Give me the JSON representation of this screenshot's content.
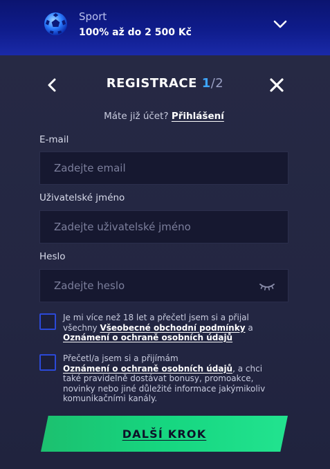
{
  "banner": {
    "title": "Sport",
    "offer": "100% až do 2 500 Kč",
    "icon": "football-icon",
    "accent": "#0f1c8c"
  },
  "header": {
    "title": "REGISTRACE",
    "step_current": "1",
    "step_total": "/2"
  },
  "login": {
    "prompt": "Máte již účet?",
    "link": "Přihlášení"
  },
  "form": {
    "email": {
      "label": "E-mail",
      "value": "",
      "placeholder": "Zadejte email"
    },
    "username": {
      "label": "Uživatelské jméno",
      "value": "",
      "placeholder": "Zadejte uživatelské jméno"
    },
    "password": {
      "label": "Heslo",
      "value": "",
      "placeholder": "Zadejte heslo"
    }
  },
  "consents": [
    {
      "checked": false,
      "text_before": "Je mi více než 18 let a přečetl jsem si a přijal všechny ",
      "link1": "Všeobecné obchodní podmínky",
      "text_mid": " a ",
      "link2": "Oznámení o ochraně osobních údajů"
    },
    {
      "checked": false,
      "text_before": "Přečetl/a jsem si a přijímám ",
      "link1": "Oznámení o ochraně osobních údajů",
      "text_after": ", a chci také pravidelně dostávat bonusy, promoakce, novinky nebo jiné důležité informace jakýmikoliv komunikačními kanály."
    }
  ],
  "cta": {
    "label": "DALŠÍ KROK",
    "color": "#16d680"
  }
}
